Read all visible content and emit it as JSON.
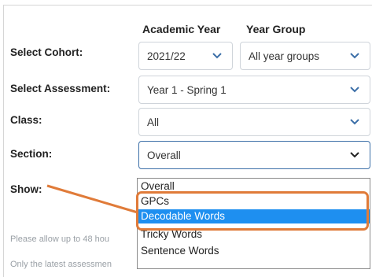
{
  "columns": {
    "academic_year": "Academic Year",
    "year_group": "Year Group"
  },
  "rows": {
    "cohort": {
      "label": "Select Cohort:",
      "year_value": "2021/22",
      "group_value": "All year groups"
    },
    "assessment": {
      "label": "Select Assessment:",
      "value": "Year 1 - Spring 1"
    },
    "class": {
      "label": "Class:",
      "value": "All"
    },
    "section": {
      "label": "Section:",
      "value": "Overall"
    },
    "show": {
      "label": "Show:"
    }
  },
  "dropdown": {
    "options": [
      "Overall",
      "GPCs",
      "Decodable Words",
      "Tricky Words",
      "Sentence Words"
    ],
    "selected_index": 2
  },
  "notices": {
    "first": "Please allow up to 48 hou",
    "second": "Only the latest assessmen"
  },
  "colors": {
    "highlight": "#e07b39",
    "selected_option": "#1e8ff0",
    "chevron": "#3c6fa8"
  }
}
